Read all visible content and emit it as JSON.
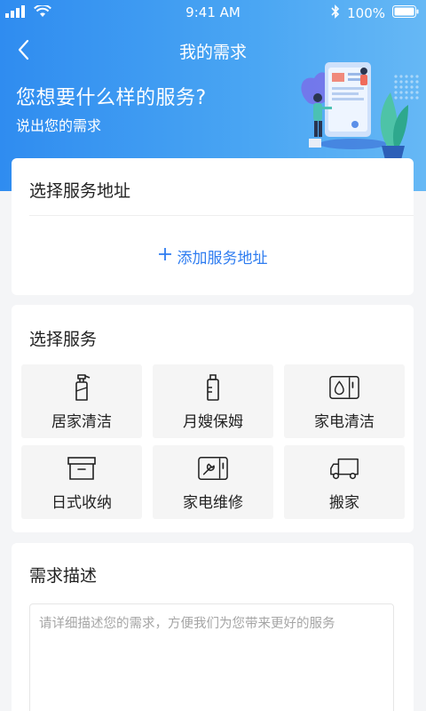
{
  "status_bar": {
    "time": "9:41 AM",
    "battery": "100%"
  },
  "nav": {
    "title": "我的需求"
  },
  "hero": {
    "title": "您想要什么样的服务?",
    "subtitle": "说出您的需求"
  },
  "address": {
    "title": "选择服务地址",
    "add_label": "添加服务地址"
  },
  "services": {
    "title": "选择服务",
    "items": [
      {
        "label": "居家清洁",
        "icon": "spray-bottle-icon"
      },
      {
        "label": "月嫂保姆",
        "icon": "baby-bottle-icon"
      },
      {
        "label": "家电清洁",
        "icon": "washing-machine-icon"
      },
      {
        "label": "日式收纳",
        "icon": "storage-box-icon"
      },
      {
        "label": "家电维修",
        "icon": "wrench-appliance-icon"
      },
      {
        "label": "搬家",
        "icon": "truck-icon"
      }
    ]
  },
  "description": {
    "title": "需求描述",
    "placeholder": "请详细描述您的需求，方便我们为您带来更好的服务",
    "value": ""
  },
  "colors": {
    "primary": "#2e7cf0",
    "hero_start": "#2f8cf0",
    "hero_end": "#66b8f5"
  }
}
